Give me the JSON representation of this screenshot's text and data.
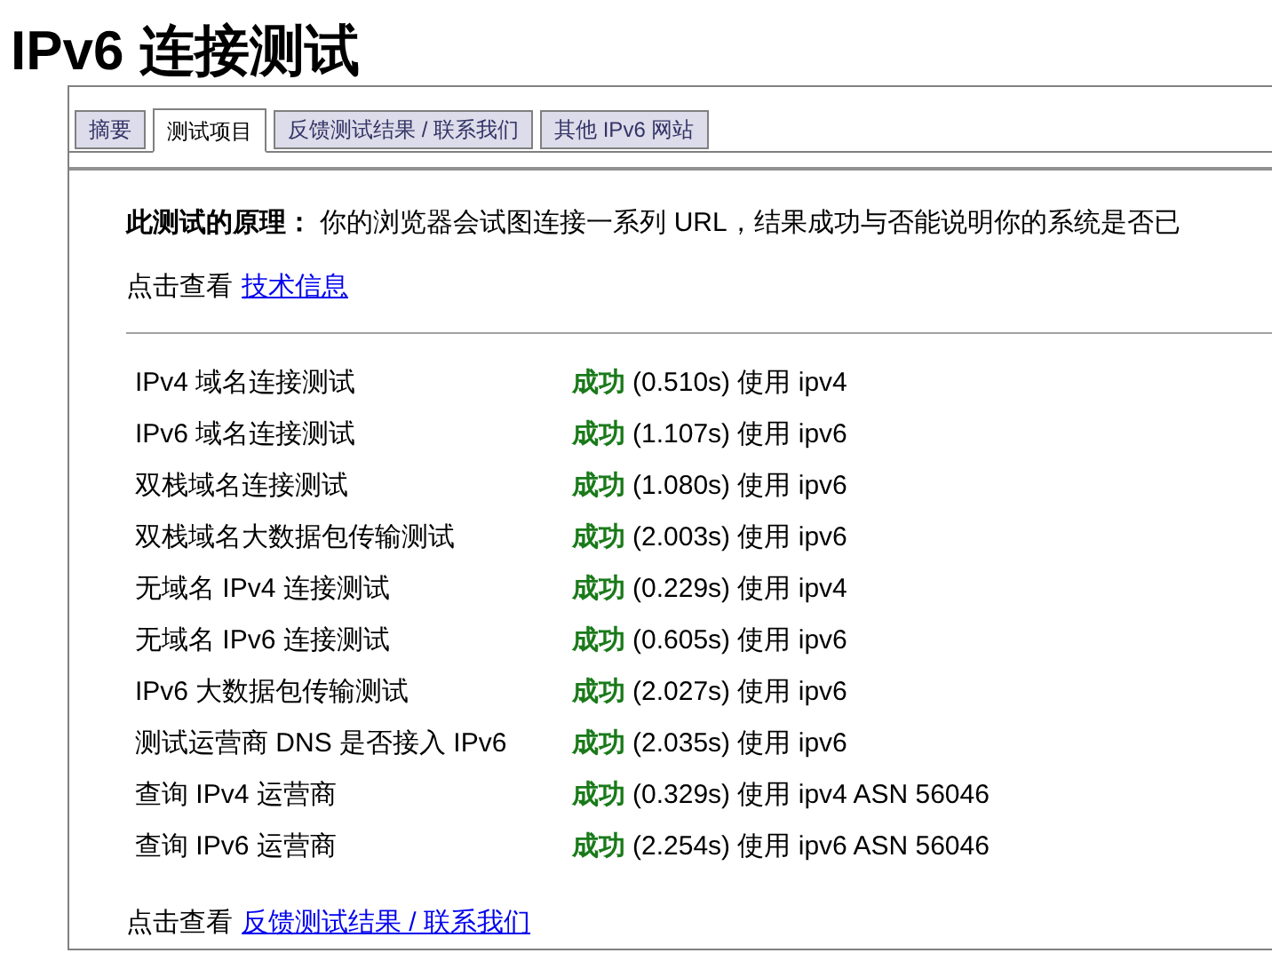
{
  "title": "IPv6 连接测试",
  "tabs": [
    {
      "label": "摘要",
      "selected": false
    },
    {
      "label": "测试项目",
      "selected": true
    },
    {
      "label": "反馈测试结果 / 联系我们",
      "selected": false
    },
    {
      "label": "其他 IPv6 网站",
      "selected": false
    }
  ],
  "principle": {
    "label": "此测试的原理：",
    "text": "你的浏览器会试图连接一系列 URL，结果成功与否能说明你的系统是否已"
  },
  "tech_info": {
    "prefix": "点击查看",
    "link": "技术信息"
  },
  "tests": [
    {
      "name": "IPv4 域名连接测试",
      "status": "成功",
      "kind": "success",
      "detail": "(0.510s) 使用 ipv4"
    },
    {
      "name": "IPv6 域名连接测试",
      "status": "成功",
      "kind": "success",
      "detail": "(1.107s) 使用 ipv6"
    },
    {
      "name": "双栈域名连接测试",
      "status": "成功",
      "kind": "success",
      "detail": "(1.080s) 使用 ipv6"
    },
    {
      "name": "双栈域名大数据包传输测试",
      "status": "成功",
      "kind": "success",
      "detail": "(2.003s) 使用 ipv6"
    },
    {
      "name": "无域名 IPv4 连接测试",
      "status": "成功",
      "kind": "success",
      "detail": "(0.229s) 使用 ipv4"
    },
    {
      "name": "无域名 IPv6 连接测试",
      "status": "成功",
      "kind": "success",
      "detail": "(0.605s) 使用 ipv6"
    },
    {
      "name": "IPv6 大数据包传输测试",
      "status": "成功",
      "kind": "success",
      "detail": "(2.027s) 使用 ipv6"
    },
    {
      "name": "测试运营商 DNS 是否接入 IPv6",
      "status": "成功",
      "kind": "success",
      "detail": "(2.035s) 使用 ipv6"
    },
    {
      "name": "查询 IPv4 运营商",
      "status": "成功",
      "kind": "success",
      "detail": "(0.329s) 使用 ipv4 ASN 56046"
    },
    {
      "name": "查询 IPv6 运营商",
      "status": "成功",
      "kind": "success",
      "detail": "(2.254s) 使用 ipv6 ASN 56046"
    }
  ],
  "feedback": {
    "prefix": "点击查看",
    "link": "反馈测试结果 / 联系我们"
  }
}
